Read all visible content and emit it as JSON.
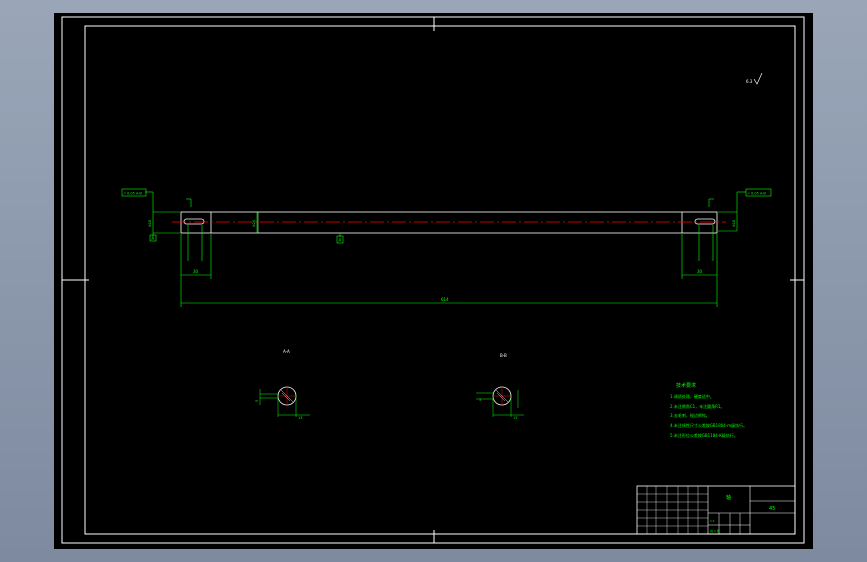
{
  "drawing": {
    "title_cn": "轴",
    "roughness": "6.3",
    "overall_length": "614",
    "left_len": "30",
    "right_len": "30",
    "shaft_dia": "Φ20",
    "left_end_dia": "Φ16",
    "right_end_dia": "Φ16",
    "datum_a": "A",
    "left_tol": "↗ 0.05 A-B",
    "right_tol": "↗ 0.05 A-B",
    "section_a": "A-A",
    "section_b": "B-B",
    "section_a_dim": "5",
    "section_b_dim": "5",
    "section_a_key": "13",
    "section_b_key": "13",
    "tech_title": "技术要求",
    "tech_notes": [
      "1.调质处理，硬度适中。",
      "2.未注倒角C1，未注圆角R1。",
      "3.去毛刺，锐边倒钝。",
      "4.未注线性尺寸公差按GB1804-m级执行。",
      "5.未注形位公差按GB1184-K级执行。"
    ],
    "title_block": {
      "name": "轴",
      "material": "45",
      "scale": "1:1",
      "sheet": "共 1 张"
    }
  },
  "colors": {
    "background": "#000000",
    "border": "#ffffff",
    "dimension": "#00ff00",
    "centerline": "#ff0000",
    "window_bg": "#8b97ab"
  }
}
